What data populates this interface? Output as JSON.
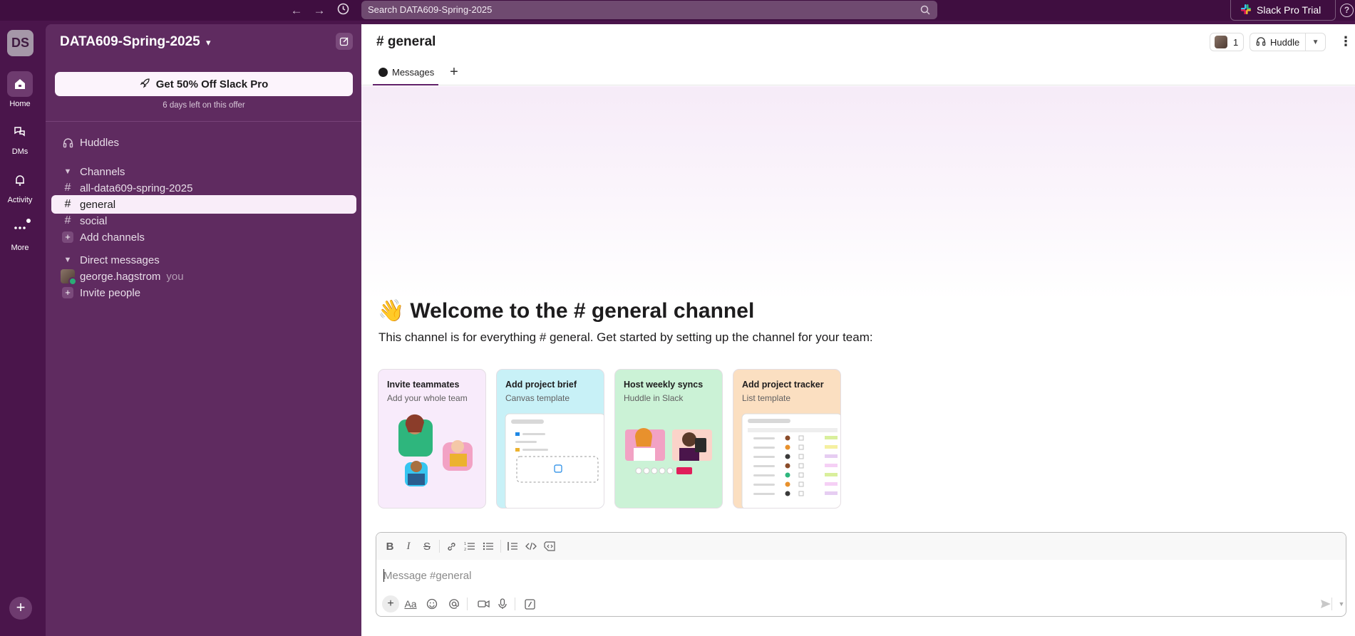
{
  "topbar": {
    "search_placeholder": "Search DATA609-Spring-2025",
    "pro_trial_label": "Slack Pro Trial",
    "help_label": "?"
  },
  "rail": {
    "workspace_initials": "DS",
    "items": [
      {
        "label": "Home",
        "icon": "home-icon"
      },
      {
        "label": "DMs",
        "icon": "dms-icon"
      },
      {
        "label": "Activity",
        "icon": "bell-icon"
      },
      {
        "label": "More",
        "icon": "more-icon"
      }
    ],
    "add_label": "+"
  },
  "sidebar": {
    "workspace_name": "DATA609-Spring-2025",
    "workspace_chevron": "⌄",
    "promo_button": "Get 50% Off Slack Pro",
    "promo_subtext": "6 days left on this offer",
    "huddles_label": "Huddles",
    "channels_header": "Channels",
    "channels": [
      "all-data609-spring-2025",
      "general",
      "social"
    ],
    "active_channel": "general",
    "add_channels_label": "Add channels",
    "dm_header": "Direct messages",
    "dm_user": "george.hagstrom",
    "dm_you_tag": "you",
    "invite_label": "Invite people"
  },
  "header": {
    "channel_title": "# general",
    "member_count": "1",
    "huddle_label": "Huddle",
    "kebab": "⋮"
  },
  "tabs": {
    "messages_label": "Messages",
    "add_tab": "+"
  },
  "welcome": {
    "emoji": "👋",
    "title": "Welcome to the # general channel",
    "subtitle": "This channel is for everything # general. Get started by setting up the channel for your team:"
  },
  "cards": [
    {
      "title": "Invite teammates",
      "subtitle": "Add your whole team",
      "bg": "#f8ebfb"
    },
    {
      "title": "Add project brief",
      "subtitle": "Canvas template",
      "bg": "#c8f1f7"
    },
    {
      "title": "Host weekly syncs",
      "subtitle": "Huddle in Slack",
      "bg": "#cbf2d6"
    },
    {
      "title": "Add project tracker",
      "subtitle": "List template",
      "bg": "#fbdfc1"
    }
  ],
  "composer": {
    "placeholder": "Message #general",
    "format_labels": {
      "bold": "B",
      "italic": "I",
      "strike": "S"
    },
    "text_format_label": "Aa"
  },
  "colors": {
    "aubergine_dark": "#3f0e40",
    "aubergine": "#4a154b",
    "sidebar": "#5f2b60",
    "active_row": "#f9edf9",
    "online": "#2bac76"
  }
}
